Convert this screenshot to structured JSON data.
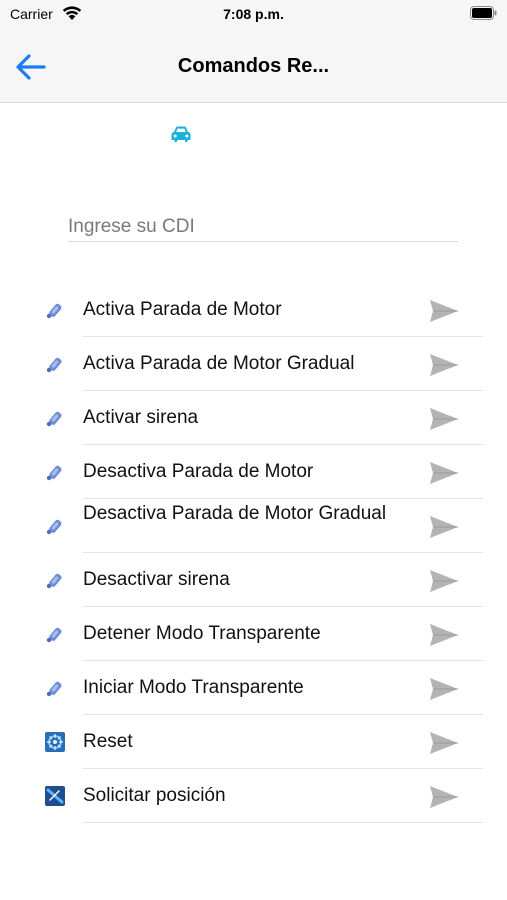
{
  "status_bar": {
    "carrier": "Carrier",
    "time": "7:08 p.m."
  },
  "nav": {
    "title": "Comandos Re...",
    "back_icon": "arrow-left-icon",
    "accent_color": "#1a7cf0"
  },
  "vehicle_icon": {
    "name": "car-icon",
    "color": "#19b3d8"
  },
  "cdi_field": {
    "placeholder": "Ingrese su CDI",
    "value": ""
  },
  "commands": [
    {
      "label": "Activa Parada de Motor",
      "icon": "satellite-icon"
    },
    {
      "label": "Activa Parada de Motor Gradual",
      "icon": "satellite-icon"
    },
    {
      "label": "Activar sirena",
      "icon": "satellite-icon"
    },
    {
      "label": "Desactiva Parada de Motor",
      "icon": "satellite-icon"
    },
    {
      "label": "Desactiva Parada de Motor Gradual",
      "icon": "satellite-icon"
    },
    {
      "label": "Desactivar sirena",
      "icon": "satellite-icon"
    },
    {
      "label": "Detener Modo Transparente",
      "icon": "satellite-icon"
    },
    {
      "label": "Iniciar Modo Transparente",
      "icon": "satellite-icon"
    },
    {
      "label": "Reset",
      "icon": "reset-icon"
    },
    {
      "label": "Solicitar posición",
      "icon": "position-icon"
    }
  ]
}
